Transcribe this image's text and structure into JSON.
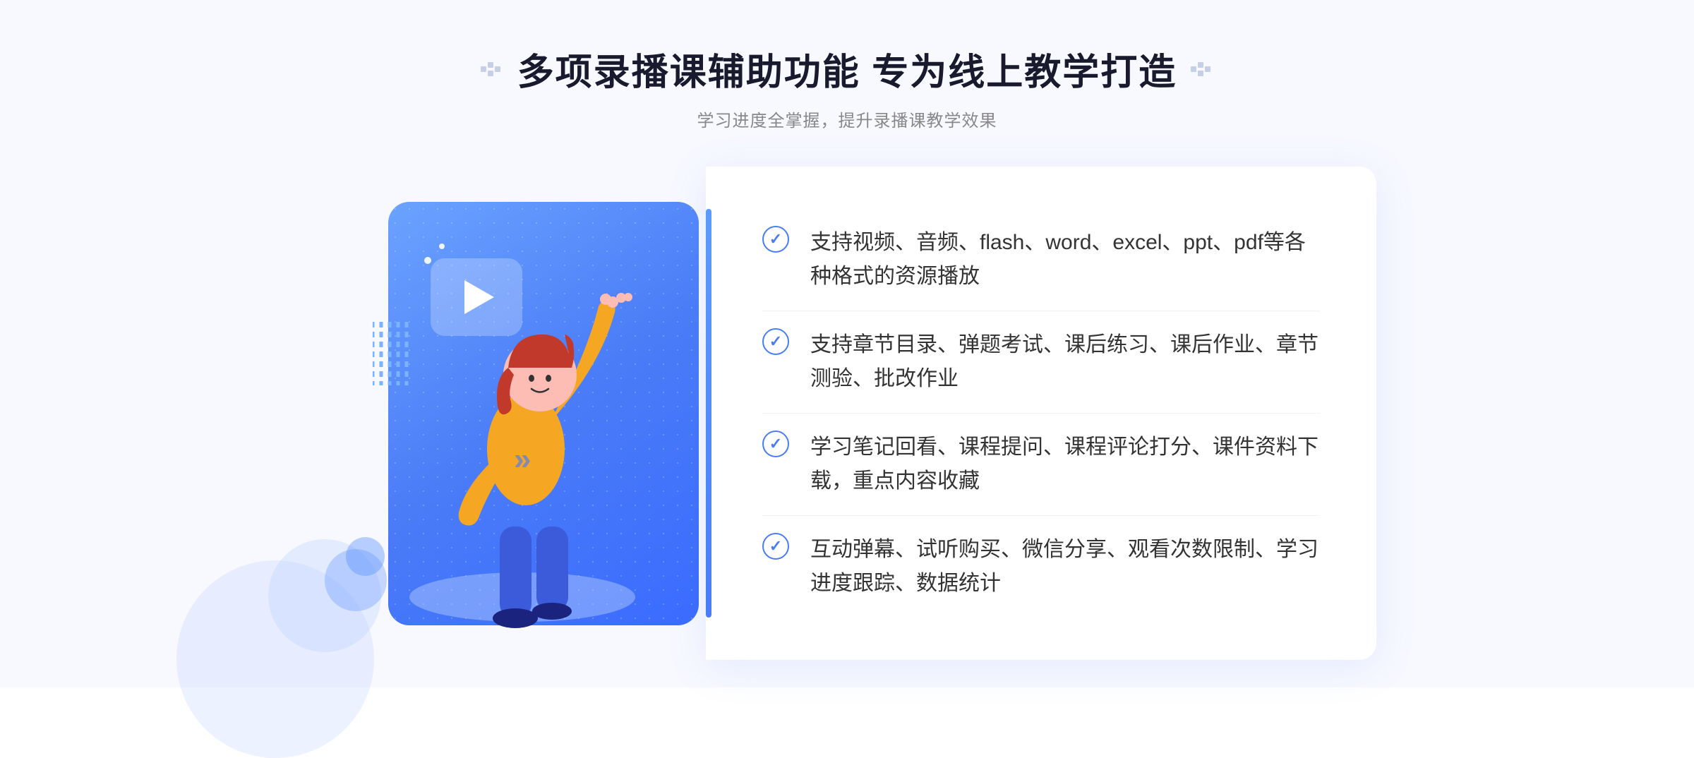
{
  "page": {
    "background_color": "#f5f7ff"
  },
  "header": {
    "title": "多项录播课辅助功能 专为线上教学打造",
    "subtitle": "学习进度全掌握，提升录播课教学效果",
    "title_deco_left": "❖",
    "title_deco_right": "❖"
  },
  "features": [
    {
      "id": 1,
      "text": "支持视频、音频、flash、word、excel、ppt、pdf等各种格式的资源播放"
    },
    {
      "id": 2,
      "text": "支持章节目录、弹题考试、课后练习、课后作业、章节测验、批改作业"
    },
    {
      "id": 3,
      "text": "学习笔记回看、课程提问、课程评论打分、课件资料下载，重点内容收藏"
    },
    {
      "id": 4,
      "text": "互动弹幕、试听购买、微信分享、观看次数限制、学习进度跟踪、数据统计"
    }
  ],
  "decoration": {
    "left_arrow": "»",
    "play_label": "play-button",
    "check_icon": "✓"
  }
}
